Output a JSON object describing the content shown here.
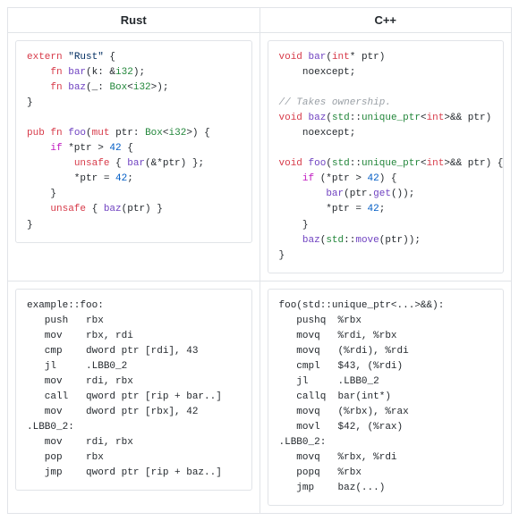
{
  "headers": {
    "left": "Rust",
    "right": "C++"
  },
  "rust_src": {
    "l1": {
      "a": "extern",
      "b": " ",
      "c": "\"Rust\"",
      "d": " {"
    },
    "l2": {
      "a": "    ",
      "b": "fn",
      "c": " ",
      "d": "bar",
      "e": "(k: &",
      "f": "i32",
      "g": ");"
    },
    "l3": {
      "a": "    ",
      "b": "fn",
      "c": " ",
      "d": "baz",
      "e": "(_: ",
      "f": "Box",
      "g": "<",
      "h": "i32",
      "i": ">);"
    },
    "l4": {
      "a": "}"
    },
    "l5": {
      "a": ""
    },
    "l6": {
      "a": "pub",
      "b": " ",
      "c": "fn",
      "d": " ",
      "e": "foo",
      "f": "(",
      "g": "mut",
      "h": " ptr: ",
      "i": "Box",
      "j": "<",
      "k": "i32",
      "l": ">) {"
    },
    "l7": {
      "a": "    ",
      "b": "if",
      "c": " *ptr > ",
      "d": "42",
      "e": " {"
    },
    "l8": {
      "a": "        ",
      "b": "unsafe",
      "c": " { ",
      "d": "bar",
      "e": "(&*ptr) };"
    },
    "l9": {
      "a": "        *ptr = ",
      "b": "42",
      "c": ";"
    },
    "l10": {
      "a": "    }"
    },
    "l11": {
      "a": "    ",
      "b": "unsafe",
      "c": " { ",
      "d": "baz",
      "e": "(ptr) }"
    },
    "l12": {
      "a": "}"
    }
  },
  "cpp_src": {
    "l1": {
      "a": "void",
      "b": " ",
      "c": "bar",
      "d": "(",
      "e": "int",
      "f": "* ptr)"
    },
    "l2": {
      "a": "    noexcept;"
    },
    "l3": {
      "a": ""
    },
    "l4": {
      "a": "// Takes ownership."
    },
    "l5": {
      "a": "void",
      "b": " ",
      "c": "baz",
      "d": "(",
      "e": "std",
      "f": "::",
      "g": "unique_ptr",
      "h": "<",
      "i": "int",
      "j": ">&& ptr)"
    },
    "l6": {
      "a": "    noexcept;"
    },
    "l7": {
      "a": ""
    },
    "l8": {
      "a": "void",
      "b": " ",
      "c": "foo",
      "d": "(",
      "e": "std",
      "f": "::",
      "g": "unique_ptr",
      "h": "<",
      "i": "int",
      "j": ">&& ptr) {"
    },
    "l9": {
      "a": "    ",
      "b": "if",
      "c": " (*ptr > ",
      "d": "42",
      "e": ") {"
    },
    "l10": {
      "a": "        ",
      "b": "bar",
      "c": "(ptr.",
      "d": "get",
      "e": "());"
    },
    "l11": {
      "a": "        *ptr = ",
      "b": "42",
      "c": ";"
    },
    "l12": {
      "a": "    }"
    },
    "l13": {
      "a": "    ",
      "b": "baz",
      "c": "(",
      "d": "std",
      "e": "::",
      "f": "move",
      "g": "(ptr));"
    },
    "l14": {
      "a": "}"
    }
  },
  "rust_asm": {
    "l1": "example::foo:",
    "l2": "   push   rbx",
    "l3": "   mov    rbx, rdi",
    "l4": "   cmp    dword ptr [rdi], 43",
    "l5": "   jl     .LBB0_2",
    "l6": "   mov    rdi, rbx",
    "l7": "   call   qword ptr [rip + bar..]",
    "l8": "   mov    dword ptr [rbx], 42",
    "l9": ".LBB0_2:",
    "l10": "   mov    rdi, rbx",
    "l11": "   pop    rbx",
    "l12": "   jmp    qword ptr [rip + baz..]"
  },
  "cpp_asm": {
    "l1": "foo(std::unique_ptr<...>&&):",
    "l2": "   pushq  %rbx",
    "l3": "   movq   %rdi, %rbx",
    "l4": "   movq   (%rdi), %rdi",
    "l5": "   cmpl   $43, (%rdi)",
    "l6": "   jl     .LBB0_2",
    "l7": "   callq  bar(int*)",
    "l8": "   movq   (%rbx), %rax",
    "l9": "   movl   $42, (%rax)",
    "l10": ".LBB0_2:",
    "l11": "   movq   %rbx, %rdi",
    "l12": "   popq   %rbx",
    "l13": "   jmp    baz(...)"
  }
}
